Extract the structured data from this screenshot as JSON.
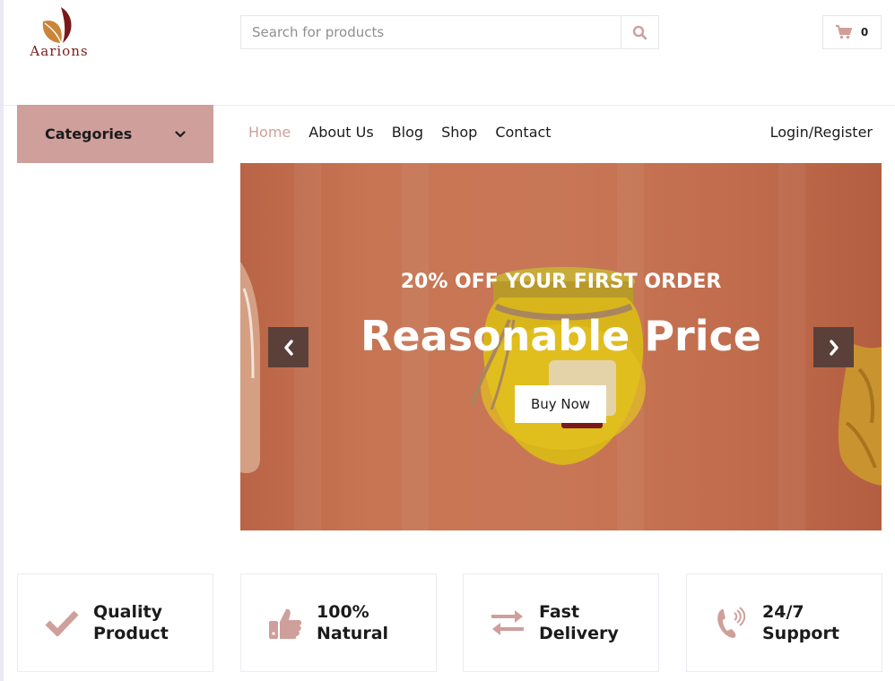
{
  "brand": {
    "name": "Aarions"
  },
  "search": {
    "placeholder": "Search for products"
  },
  "cart": {
    "count": "0"
  },
  "categories": {
    "label": "Categories"
  },
  "nav": {
    "items": [
      {
        "label": "Home",
        "active": true
      },
      {
        "label": "About Us"
      },
      {
        "label": "Blog"
      },
      {
        "label": "Shop"
      },
      {
        "label": "Contact"
      }
    ],
    "login": "Login/Register"
  },
  "hero": {
    "subtitle": "20% OFF YOUR FIRST ORDER",
    "title": "Reasonable Price",
    "cta": "Buy Now"
  },
  "features": [
    {
      "icon": "check-icon",
      "line1": "Quality",
      "line2": "Product"
    },
    {
      "icon": "thumbs-up-icon",
      "line1": "100%",
      "line2": "Natural"
    },
    {
      "icon": "exchange-icon",
      "line1": "Fast",
      "line2": "Delivery"
    },
    {
      "icon": "phone-icon",
      "line1": "24/7",
      "line2": "Support"
    }
  ],
  "colors": {
    "accent": "#cf9f9b",
    "hero_bg": "#c87756",
    "arrow_bg": "#5a4038",
    "logo_red": "#7a1a18"
  }
}
